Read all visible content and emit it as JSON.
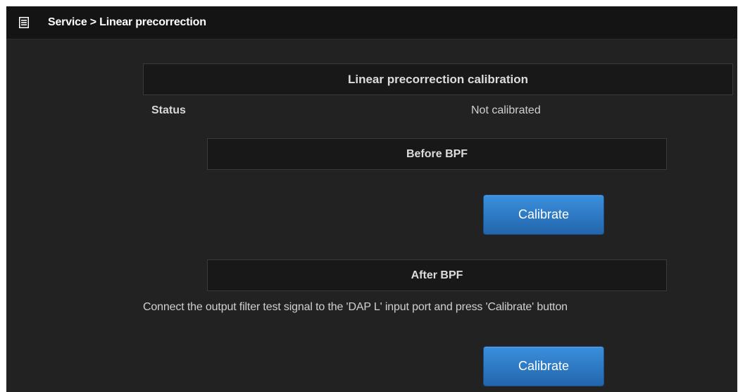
{
  "header": {
    "icon": "list-icon",
    "title": "Service > Linear precorrection"
  },
  "calibration": {
    "title": "Linear precorrection calibration",
    "status_label": "Status",
    "status_value": "Not calibrated"
  },
  "before_bpf": {
    "title": "Before BPF",
    "button_label": "Calibrate"
  },
  "after_bpf": {
    "title": "After BPF",
    "instruction": "Connect the output filter test signal to the 'DAP L' input port and press 'Calibrate' button",
    "button_label": "Calibrate"
  },
  "colors": {
    "panel_bg": "#222222",
    "header_bg": "#141414",
    "accent": "#2a77c7"
  }
}
